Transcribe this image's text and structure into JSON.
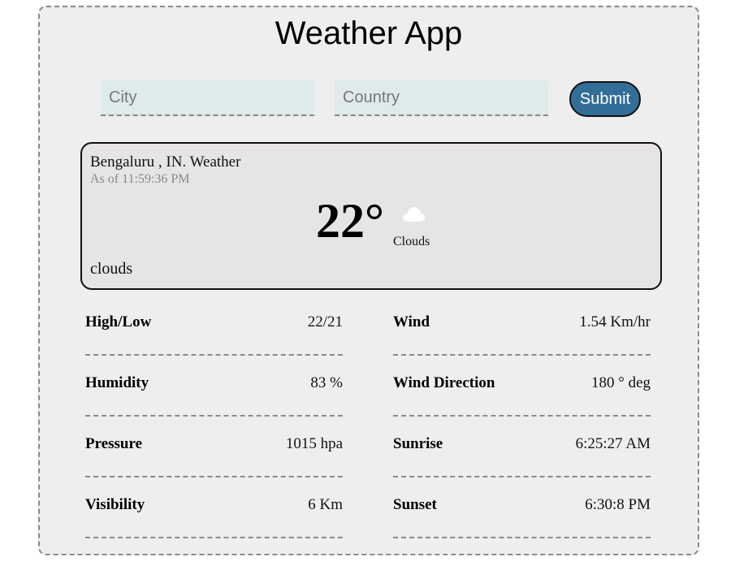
{
  "app": {
    "title": "Weather App"
  },
  "form": {
    "city_placeholder": "City",
    "country_placeholder": "Country",
    "submit_label": "Submit"
  },
  "current": {
    "location": "Bengaluru , IN. Weather",
    "as_of": "As of 11:59:36 PM",
    "temperature": "22°",
    "condition_icon": "cloud-icon",
    "condition_short": "Clouds",
    "condition_desc": "clouds"
  },
  "stats": {
    "left": [
      {
        "label": "High/Low",
        "value": "22/21"
      },
      {
        "label": "Humidity",
        "value": "83 %"
      },
      {
        "label": "Pressure",
        "value": "1015 hpa"
      },
      {
        "label": "Visibility",
        "value": "6 Km"
      }
    ],
    "right": [
      {
        "label": "Wind",
        "value": "1.54 Km/hr"
      },
      {
        "label": "Wind Direction",
        "value": "180 ° deg"
      },
      {
        "label": "Sunrise",
        "value": "6:25:27 AM"
      },
      {
        "label": "Sunset",
        "value": "6:30:8 PM"
      }
    ]
  },
  "colors": {
    "submit_bg": "#336e98",
    "input_bg": "#dfeaea",
    "card_bg": "#e7e4e5",
    "app_bg": "#eeeeee"
  }
}
